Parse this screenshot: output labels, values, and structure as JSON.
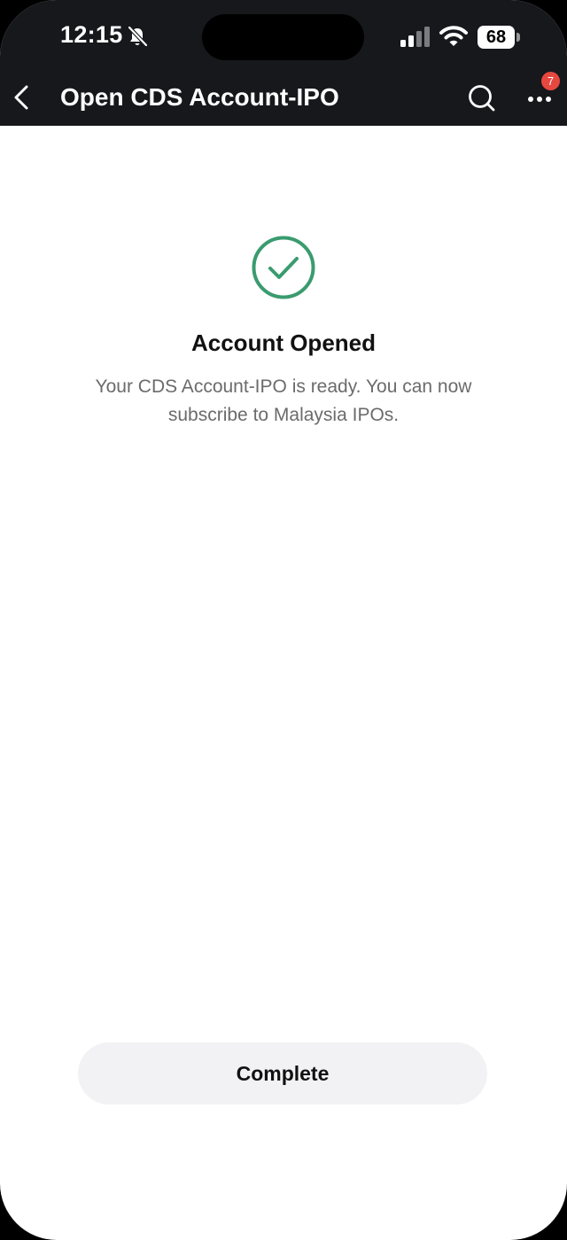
{
  "status_bar": {
    "time": "12:15",
    "battery": "68",
    "icons": [
      "bell-slash-icon",
      "cellular-signal-icon",
      "wifi-icon",
      "battery-icon"
    ]
  },
  "nav": {
    "title": "Open CDS Account-IPO",
    "back_icon": "chevron-left-icon",
    "search_icon": "search-icon",
    "more_icon": "more-horizontal-icon",
    "notification_count": "7"
  },
  "result": {
    "icon": "check-circle-icon",
    "icon_color": "#3a9b6f",
    "title": "Account Opened",
    "message": "Your CDS Account-IPO is ready. You can now subscribe to Malaysia IPOs."
  },
  "actions": {
    "complete_label": "Complete"
  }
}
